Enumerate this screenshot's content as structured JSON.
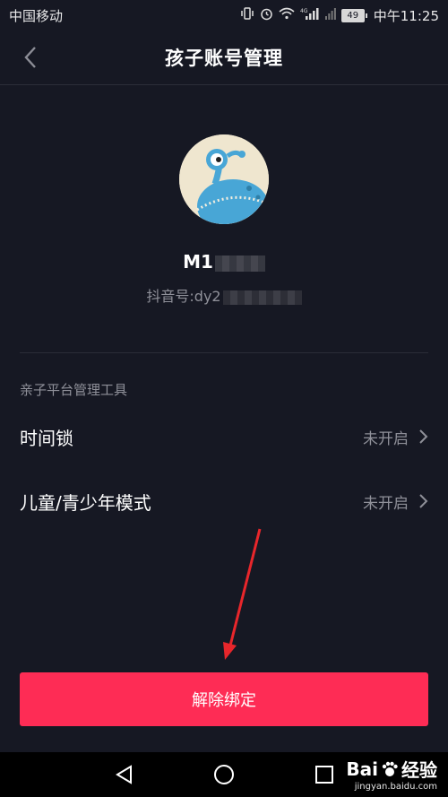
{
  "status_bar": {
    "carrier": "中国移动",
    "battery_level": "49",
    "signal_tag": "4G",
    "time": "中午11:25"
  },
  "nav": {
    "title": "孩子账号管理"
  },
  "profile": {
    "username": "M1",
    "douyin_id": "抖音号:dy2"
  },
  "section": {
    "label": "亲子平台管理工具"
  },
  "rows": [
    {
      "label": "时间锁",
      "value": "未开启"
    },
    {
      "label": "儿童/青少年模式",
      "value": "未开启"
    }
  ],
  "unbind_button": {
    "label": "解除绑定"
  },
  "watermark": {
    "brand": "Bai",
    "brand_suffix": "经验",
    "url": "jingyan.baidu.com"
  },
  "colors": {
    "background": "#161823",
    "accent": "#fe2c55",
    "secondary_text": "#8f9099",
    "annotation_arrow": "#e8262b"
  },
  "icons": {
    "back": "chevron-left-icon",
    "row_chevron": "chevron-right-icon",
    "system_back": "triangle-back-icon",
    "system_home": "circle-home-icon",
    "system_recent": "square-recent-icon"
  }
}
